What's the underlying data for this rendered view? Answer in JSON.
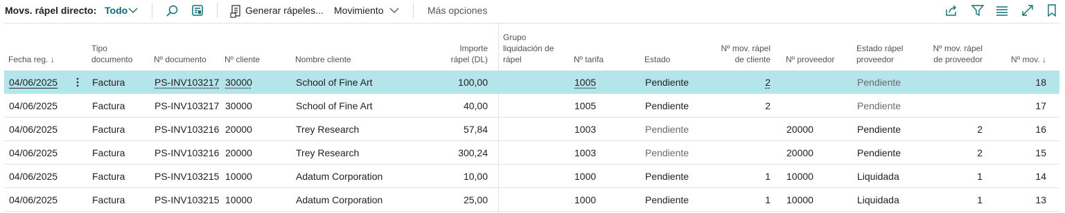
{
  "toolbar": {
    "title": "Movs. rápel directo:",
    "filter": "Todo",
    "generate": "Generar rápeles...",
    "movement": "Movimiento",
    "more": "Más opciones"
  },
  "headers": {
    "fecha": "Fecha reg. ↓",
    "tipo1": "Tipo",
    "tipo2": "documento",
    "ndoc": "Nº documento",
    "ncli": "Nº cliente",
    "nombre": "Nombre cliente",
    "imp1": "Importe",
    "imp2": "rápel (DL)",
    "grupo1": "Grupo",
    "grupo2": "liquidación de",
    "grupo3": "rápel",
    "tarifa": "Nº tarifa",
    "estado": "Estado",
    "nmc1": "Nº mov. rápel",
    "nmc2": "de cliente",
    "nprov": "Nº proveedor",
    "erp1": "Estado rápel",
    "erp2": "proveedor",
    "nmp1": "Nº mov. rápel",
    "nmp2": "de proveedor",
    "nmov": "Nº mov. ↓"
  },
  "rows": [
    {
      "fecha": "04/06/2025",
      "tipo": "Factura",
      "ndoc": "PS-INV103217",
      "ncli": "30000",
      "nombre": "School of Fine Art",
      "importe": "100,00",
      "tarifa": "1005",
      "estado": "Pendiente",
      "nmc": "2",
      "nprov": "",
      "erp": "Pendiente",
      "nmp": "",
      "nmov": "18"
    },
    {
      "fecha": "04/06/2025",
      "tipo": "Factura",
      "ndoc": "PS-INV103217",
      "ncli": "30000",
      "nombre": "School of Fine Art",
      "importe": "40,00",
      "tarifa": "1005",
      "estado": "Pendiente",
      "nmc": "2",
      "nprov": "",
      "erp": "Pendiente",
      "nmp": "",
      "nmov": "17"
    },
    {
      "fecha": "04/06/2025",
      "tipo": "Factura",
      "ndoc": "PS-INV103216",
      "ncli": "20000",
      "nombre": "Trey Research",
      "importe": "57,84",
      "tarifa": "1003",
      "estado": "Pendiente",
      "nmc": "",
      "nprov": "20000",
      "erp": "Pendiente",
      "nmp": "2",
      "nmov": "16"
    },
    {
      "fecha": "04/06/2025",
      "tipo": "Factura",
      "ndoc": "PS-INV103216",
      "ncli": "20000",
      "nombre": "Trey Research",
      "importe": "300,24",
      "tarifa": "1003",
      "estado": "Pendiente",
      "nmc": "",
      "nprov": "20000",
      "erp": "Pendiente",
      "nmp": "2",
      "nmov": "15"
    },
    {
      "fecha": "04/06/2025",
      "tipo": "Factura",
      "ndoc": "PS-INV103215",
      "ncli": "10000",
      "nombre": "Adatum Corporation",
      "importe": "10,00",
      "tarifa": "1000",
      "estado": "Pendiente",
      "nmc": "1",
      "nprov": "10000",
      "erp": "Liquidada",
      "nmp": "1",
      "nmov": "14"
    },
    {
      "fecha": "04/06/2025",
      "tipo": "Factura",
      "ndoc": "PS-INV103215",
      "ncli": "10000",
      "nombre": "Adatum Corporation",
      "importe": "25,00",
      "tarifa": "1000",
      "estado": "Pendiente",
      "nmc": "1",
      "nprov": "10000",
      "erp": "Liquidada",
      "nmp": "1",
      "nmov": "13"
    }
  ],
  "colors": {
    "accent": "#0f6c74",
    "selected": "#b3e5eb"
  }
}
